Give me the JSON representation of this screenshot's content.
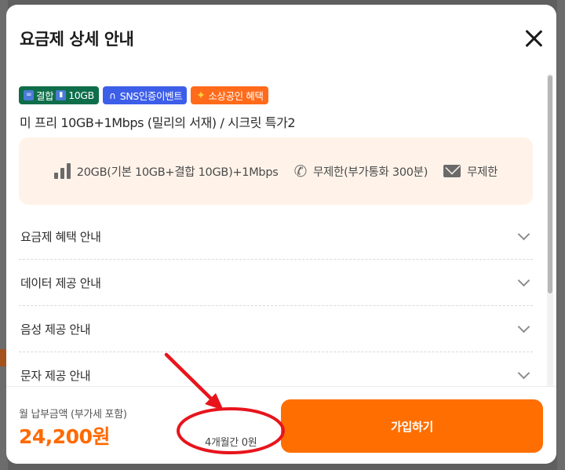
{
  "modal": {
    "title": "요금제 상세 안내"
  },
  "tags": [
    {
      "label": "결합",
      "extra": "10GB",
      "color": "#0f6e4a"
    },
    {
      "label": "SNS인증이벤트",
      "color": "#3d5ee8"
    },
    {
      "label": "소상공인 혜택",
      "color": "#ff6b1a"
    }
  ],
  "plan": {
    "name": "미 프리 10GB+1Mbps (밀리의 서재) / 시크릿 특가2"
  },
  "specs": {
    "data": "20GB(기본 10GB+결합 10GB)+1Mbps",
    "voice": "무제한(부가통화 300분)",
    "sms": "무제한"
  },
  "accordion": [
    {
      "label": "요금제 혜택 안내"
    },
    {
      "label": "데이터 제공 안내"
    },
    {
      "label": "음성 제공 안내"
    },
    {
      "label": "문자 제공 안내"
    }
  ],
  "footer": {
    "fee_label": "월 납부금액 (부가세 포함)",
    "fee_value": "24,200원",
    "discount_text": "4개월간 0원",
    "join_label": "가입하기"
  },
  "colors": {
    "accent": "#ff6e00",
    "annotation": "#e8141c"
  }
}
